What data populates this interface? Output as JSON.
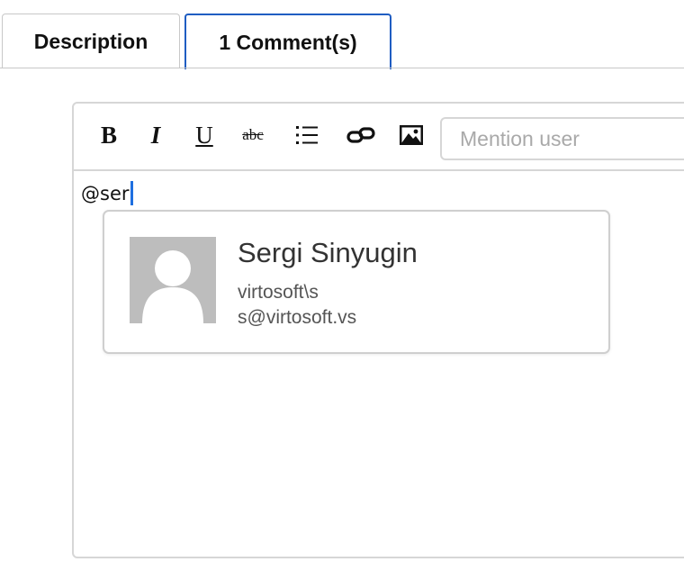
{
  "tabs": [
    {
      "label": "Description",
      "active": false
    },
    {
      "label": "1 Comment(s)",
      "active": true
    }
  ],
  "toolbar": {
    "bold": "B",
    "italic": "I",
    "underline": "U",
    "strikethrough": "abc",
    "list_icon": "bulleted-list-icon",
    "link_icon": "link-icon",
    "image_icon": "image-icon",
    "mention_placeholder": "Mention user"
  },
  "editor": {
    "text": "@ser"
  },
  "suggestion": {
    "name": "Sergi Sinyugin",
    "login": "virtosoft\\s",
    "email": "s@virtosoft.vs",
    "avatar_icon": "default-avatar-icon"
  },
  "colors": {
    "active_tab_border": "#1f5dc2",
    "caret": "#1f6fe0",
    "avatar_bg": "#bdbdbd"
  }
}
